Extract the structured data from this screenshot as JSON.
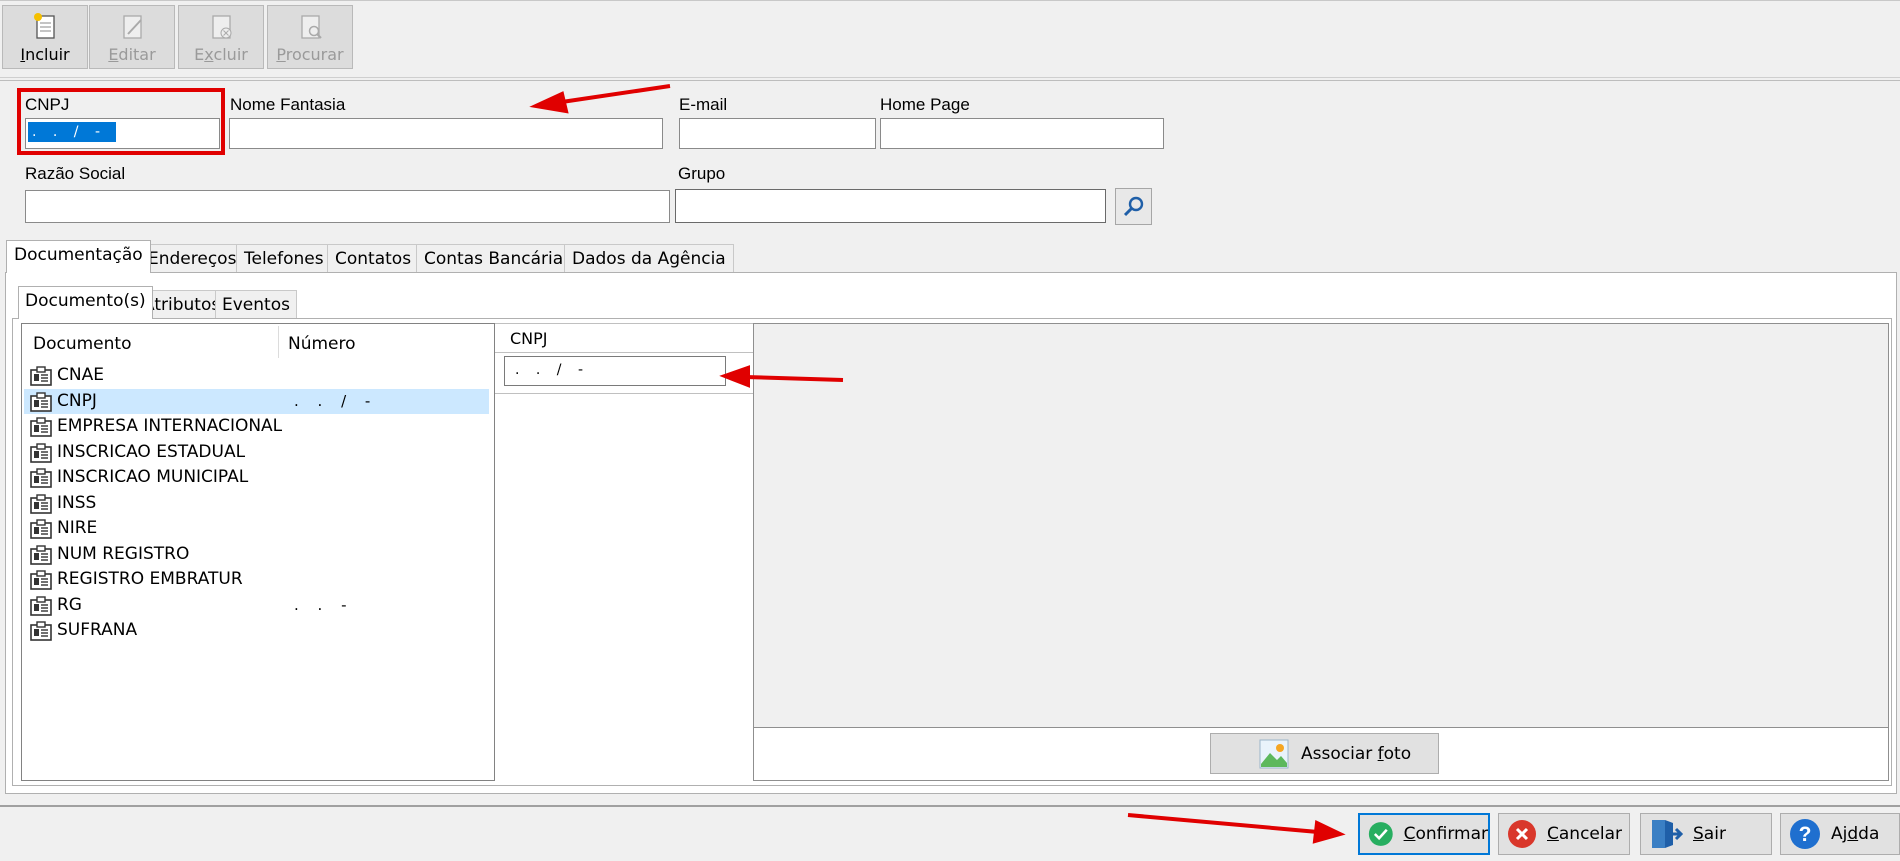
{
  "toolbar": {
    "incluir": "Incluir",
    "editar": "Editar",
    "excluir": "Excluir",
    "procurar": "Procurar"
  },
  "form": {
    "cnpj_label": "CNPJ",
    "cnpj_value": ". . / -",
    "nome_fantasia_label": "Nome Fantasia",
    "email_label": "E-mail",
    "home_page_label": "Home Page",
    "razao_social_label": "Razão Social",
    "grupo_label": "Grupo"
  },
  "tabs": [
    "Documentação",
    "Endereços",
    "Telefones",
    "Contatos",
    "Contas Bancárias",
    "Dados da Agência"
  ],
  "subtabs": [
    "Documento(s)",
    "Atributos",
    "Eventos"
  ],
  "documents": {
    "col_documento": "Documento",
    "col_numero": "Número",
    "rows": [
      {
        "name": "CNAE",
        "number": ""
      },
      {
        "name": "CNPJ",
        "number": ". . / -"
      },
      {
        "name": "EMPRESA INTERNACIONAL",
        "number": ""
      },
      {
        "name": "INSCRICAO ESTADUAL",
        "number": ""
      },
      {
        "name": "INSCRICAO MUNICIPAL",
        "number": ""
      },
      {
        "name": "INSS",
        "number": ""
      },
      {
        "name": "NIRE",
        "number": ""
      },
      {
        "name": "NUM REGISTRO",
        "number": ""
      },
      {
        "name": "REGISTRO EMBRATUR",
        "number": ""
      },
      {
        "name": "RG",
        "number": ". . -"
      },
      {
        "name": "SUFRANA",
        "number": ""
      }
    ],
    "selected_index": 1
  },
  "detail": {
    "label": "CNPJ",
    "value": ". . / -"
  },
  "photo": {
    "assoc_button": "Associar foto"
  },
  "bottom": {
    "confirmar": "Confirmar",
    "cancelar": "Cancelar",
    "sair": "Sair",
    "ajuda": "Ajuda"
  },
  "colors": {
    "accent": "#0078d7",
    "annotation": "#e00000",
    "selection": "#cce8ff",
    "confirm_green": "#27ae60",
    "cancel_red": "#d9372b",
    "help_blue": "#1f6fcf"
  }
}
